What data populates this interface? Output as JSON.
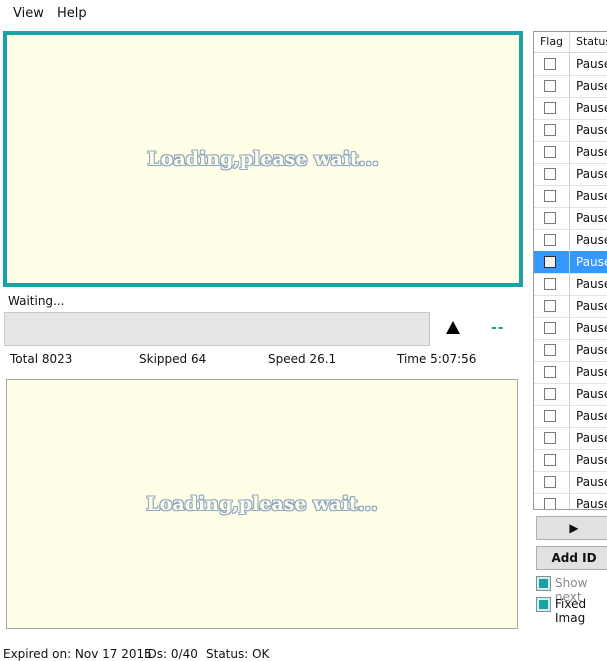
{
  "menu": {
    "items": [
      "View",
      "Help"
    ]
  },
  "preview_top": {
    "loading_text": "Loading,please wait..."
  },
  "preview_bottom": {
    "loading_text": "Loading,please wait..."
  },
  "status": {
    "waiting_text": "Waiting...",
    "indicator": "--"
  },
  "stats": {
    "total": "Total 8023",
    "skipped": "Skipped 64",
    "speed": "Speed 26.1",
    "time": "Time 5:07:56"
  },
  "grid": {
    "columns": [
      "Flag",
      "Status"
    ],
    "rows": [
      {
        "status": "Paused",
        "selected": false
      },
      {
        "status": "Paused",
        "selected": false
      },
      {
        "status": "Paused",
        "selected": false
      },
      {
        "status": "Paused",
        "selected": false
      },
      {
        "status": "Paused",
        "selected": false
      },
      {
        "status": "Paused",
        "selected": false
      },
      {
        "status": "Paused",
        "selected": false
      },
      {
        "status": "Paused",
        "selected": false
      },
      {
        "status": "Paused",
        "selected": false
      },
      {
        "status": "Paused",
        "selected": true
      },
      {
        "status": "Paused",
        "selected": false
      },
      {
        "status": "Paused",
        "selected": false
      },
      {
        "status": "Paused",
        "selected": false
      },
      {
        "status": "Paused",
        "selected": false
      },
      {
        "status": "Paused",
        "selected": false
      },
      {
        "status": "Paused",
        "selected": false
      },
      {
        "status": "Paused",
        "selected": false
      },
      {
        "status": "Paused",
        "selected": false
      },
      {
        "status": "Paused",
        "selected": false
      },
      {
        "status": "Paused",
        "selected": false
      },
      {
        "status": "Paused",
        "selected": false
      }
    ]
  },
  "buttons": {
    "play_label": "▶",
    "add_id_label": "Add ID"
  },
  "options": {
    "show_next_label": "Show next",
    "fixed_image_label": "Fixed Imag"
  },
  "footer": {
    "expired": "Expired on: Nov 17 2015",
    "ids": "IDs: 0/40",
    "status": "Status: OK"
  },
  "colors": {
    "accent": "#1aa3a3",
    "preview_bg": "#fffee6",
    "selection": "#3399ff"
  }
}
